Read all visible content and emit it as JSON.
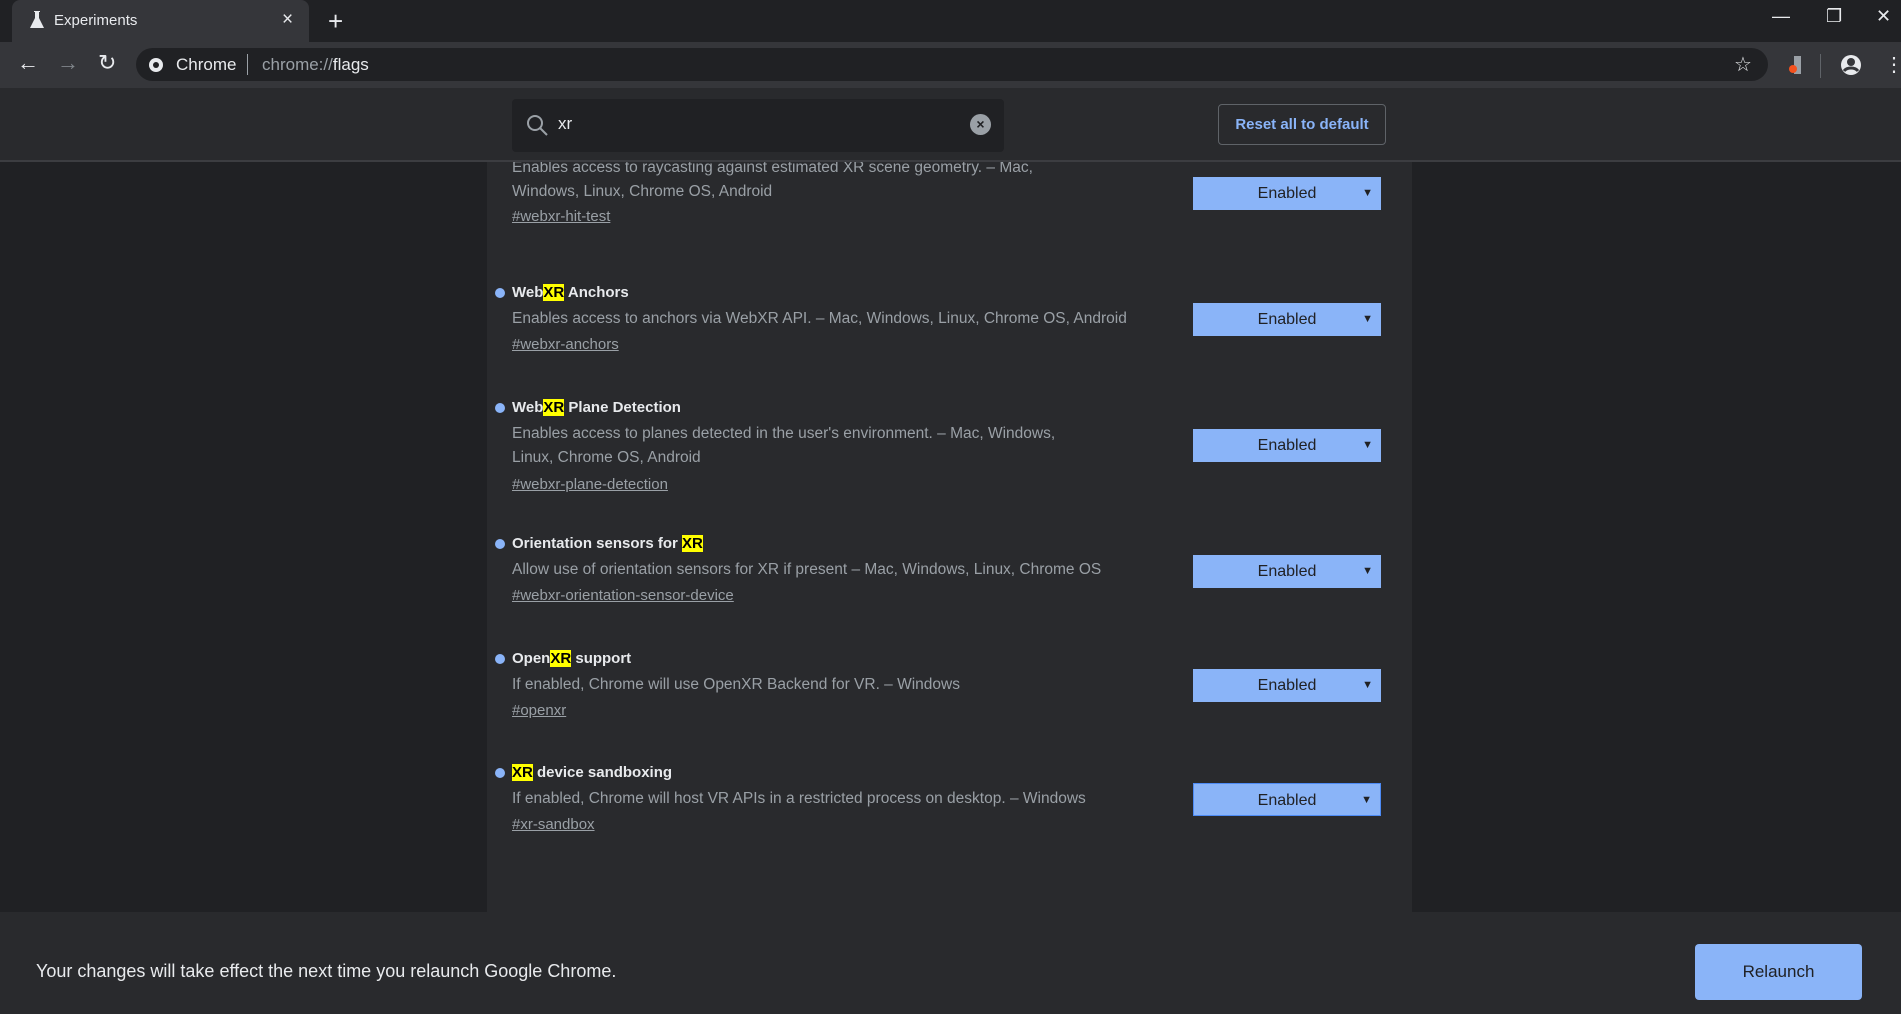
{
  "tab": {
    "title": "Experiments",
    "close": "×",
    "new_tab": "+"
  },
  "window": {
    "minimize": "—",
    "restore": "❐",
    "close": "✕"
  },
  "toolbar": {
    "back": "←",
    "forward": "→",
    "reload": "↻",
    "site": "Chrome",
    "url_scheme": "chrome://",
    "url_path": "flags",
    "star": "☆",
    "menu": "⋮"
  },
  "search": {
    "value": "xr",
    "clear": "×"
  },
  "reset_label": "Reset all to default",
  "flags": [
    {
      "title_pre": "",
      "title_hl": "",
      "title_post": "",
      "description": "Enables access to raycasting against estimated XR scene geometry. – Mac, Windows, Linux, Chrome OS, Android",
      "link": "#webxr-hit-test",
      "value": "Enabled"
    },
    {
      "title_pre": "Web",
      "title_hl": "XR",
      "title_post": " Anchors",
      "description": "Enables access to anchors via WebXR API. – Mac, Windows, Linux, Chrome OS, Android",
      "link": "#webxr-anchors",
      "value": "Enabled"
    },
    {
      "title_pre": "Web",
      "title_hl": "XR",
      "title_post": " Plane Detection",
      "description": "Enables access to planes detected in the user's environment. – Mac, Windows, Linux, Chrome OS, Android",
      "link": "#webxr-plane-detection",
      "value": "Enabled"
    },
    {
      "title_pre": "Orientation sensors for ",
      "title_hl": "XR",
      "title_post": "",
      "description": "Allow use of orientation sensors for XR if present – Mac, Windows, Linux, Chrome OS",
      "link": "#webxr-orientation-sensor-device",
      "value": "Enabled"
    },
    {
      "title_pre": "Open",
      "title_hl": "XR",
      "title_post": " support",
      "description": "If enabled, Chrome will use OpenXR Backend for VR. – Windows",
      "link": "#openxr",
      "value": "Enabled"
    },
    {
      "title_pre": "",
      "title_hl": "XR",
      "title_post": " device sandboxing",
      "description": "If enabled, Chrome will host VR APIs in a restricted process on desktop. – Windows",
      "link": "#xr-sandbox",
      "value": "Enabled"
    }
  ],
  "bottom": {
    "message": "Your changes will take effect the next time you relaunch Google Chrome.",
    "relaunch": "Relaunch"
  },
  "colors": {
    "accent": "#8ab4f8",
    "highlight": "#ffff00",
    "background": "#202124",
    "surface": "#292a2d"
  }
}
